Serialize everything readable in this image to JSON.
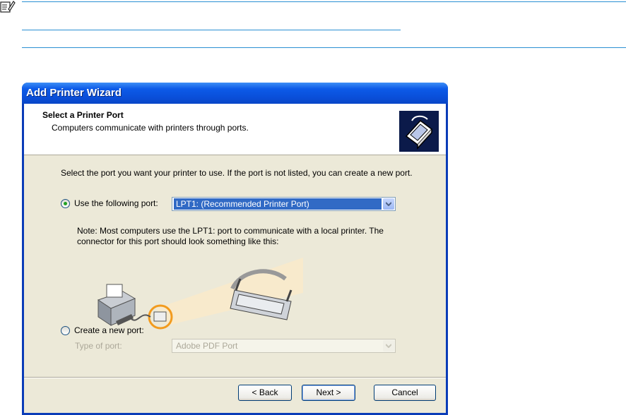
{
  "dialog": {
    "title": "Add Printer Wizard",
    "header_title": "Select a Printer Port",
    "header_subtitle": "Computers communicate with printers through ports.",
    "intro_text": "Select the port you want your printer to use.  If the port is not listed, you can create a new port.",
    "use_port_label": "Use the following port:",
    "use_port_selected": true,
    "port_value": "LPT1: (Recommended Printer Port)",
    "note_text": "Note: Most computers use the LPT1: port to communicate with a local printer. The connector for this port should look something like this:",
    "create_port_label": "Create a new port:",
    "create_port_selected": false,
    "type_of_port_label": "Type of port:",
    "type_of_port_value": "Adobe PDF Port",
    "buttons": {
      "back": "< Back",
      "next": "Next >",
      "cancel": "Cancel"
    }
  },
  "colors": {
    "title_bar": "#0a4fd9",
    "client_bg": "#ece9d8",
    "selection": "#316ac5",
    "rule": "#2a8fd3"
  }
}
